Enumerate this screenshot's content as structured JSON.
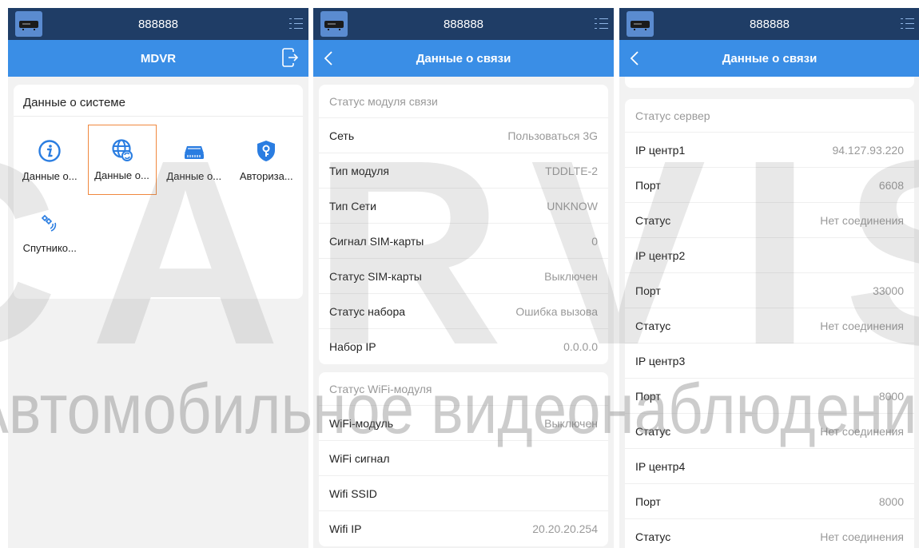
{
  "device_id": "888888",
  "panel1": {
    "nav_title": "MDVR",
    "card_title": "Данные о системе",
    "tiles": [
      {
        "label": "Данные о..."
      },
      {
        "label": "Данные о..."
      },
      {
        "label": "Данные о..."
      },
      {
        "label": "Авториза..."
      },
      {
        "label": "Спутнико..."
      }
    ]
  },
  "panel2": {
    "nav_title": "Данные о связи",
    "module_section": "Статус модуля связи",
    "module_rows": [
      {
        "label": "Сеть",
        "value": "Пользоваться 3G"
      },
      {
        "label": "Тип модуля",
        "value": "TDDLTE-2"
      },
      {
        "label": "Тип Сети",
        "value": "UNKNOW"
      },
      {
        "label": "Сигнал SIM-карты",
        "value": "0"
      },
      {
        "label": "Статус SIM-карты",
        "value": "Выключен"
      },
      {
        "label": "Статус набора",
        "value": "Ошибка вызова"
      },
      {
        "label": "Набор IP",
        "value": "0.0.0.0"
      }
    ],
    "wifi_section": "Статус WiFi-модуля",
    "wifi_rows": [
      {
        "label": "WiFi-модуль",
        "value": "Выключен"
      },
      {
        "label": "WiFi сигнал",
        "value": ""
      },
      {
        "label": "Wifi SSID",
        "value": ""
      },
      {
        "label": "Wifi IP",
        "value": "20.20.20.254"
      }
    ]
  },
  "panel3": {
    "nav_title": "Данные о связи",
    "server_section": "Статус сервер",
    "server_rows": [
      {
        "label": "IP центр1",
        "value": "94.127.93.220"
      },
      {
        "label": "Порт",
        "value": "6608"
      },
      {
        "label": "Статус",
        "value": "Нет соединения"
      },
      {
        "label": "IP центр2",
        "value": ""
      },
      {
        "label": "Порт",
        "value": "33000"
      },
      {
        "label": "Статус",
        "value": "Нет соединения"
      },
      {
        "label": "IP центр3",
        "value": ""
      },
      {
        "label": "Порт",
        "value": "8000"
      },
      {
        "label": "Статус",
        "value": "Нет соединения"
      },
      {
        "label": "IP центр4",
        "value": ""
      },
      {
        "label": "Порт",
        "value": "8000"
      },
      {
        "label": "Статус",
        "value": "Нет соединения"
      }
    ]
  },
  "watermark": {
    "brand": "CARVIS",
    "tagline": "Автомобильное видеонаблюдение"
  },
  "colors": {
    "topbar": "#1f3d66",
    "navbar": "#3a8ee6",
    "selected_border": "#f0883e",
    "icon_blue": "#2a7de1"
  }
}
